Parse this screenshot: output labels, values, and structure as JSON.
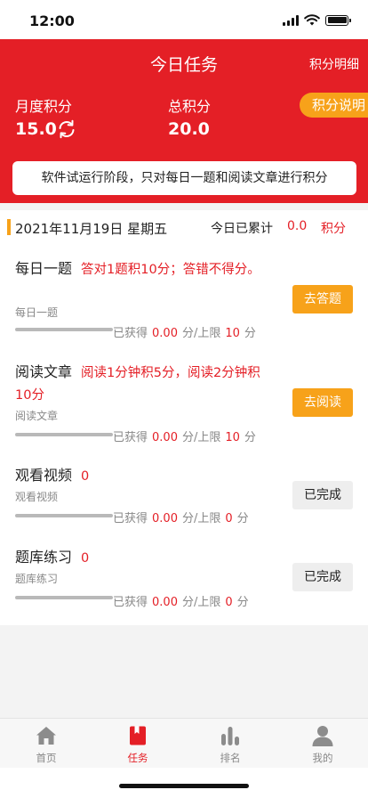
{
  "status_bar": {
    "time": "12:00"
  },
  "header": {
    "title": "今日任务",
    "detail_link": "积分明细",
    "monthly_label": "月度积分",
    "monthly_value": "15.0",
    "total_label": "总积分",
    "total_value": "20.0",
    "help_button": "积分说明",
    "notice": "软件试运行阶段，只对每日一题和阅读文章进行积分"
  },
  "summary": {
    "date": "2021年11月19日 星期五",
    "today_label": "今日已累计",
    "today_value": "0.0",
    "today_unit": "积分"
  },
  "tasks": [
    {
      "name": "每日一题",
      "rule": "答对1题积10分；答错不得分。",
      "subtitle": "每日一题",
      "earned_label": "已获得",
      "earned": "0.00",
      "limit_label": "分/上限",
      "limit": "10",
      "unit": "分",
      "progress": 0,
      "button": "去答题"
    },
    {
      "name": "阅读文章",
      "rule": "阅读1分钟积5分，阅读2分钟积10分",
      "subtitle": "阅读文章",
      "earned_label": "已获得",
      "earned": "0.00",
      "limit_label": "分/上限",
      "limit": "10",
      "unit": "分",
      "progress": 0,
      "button": "去阅读"
    },
    {
      "name": "观看视频",
      "rule": "0",
      "subtitle": "观看视频",
      "earned_label": "已获得",
      "earned": "0.00",
      "limit_label": "分/上限",
      "limit": "0",
      "unit": "分",
      "progress": 0,
      "button": "已完成"
    },
    {
      "name": "题库练习",
      "rule": "0",
      "subtitle": "题库练习",
      "earned_label": "已获得",
      "earned": "0.00",
      "limit_label": "分/上限",
      "limit": "0",
      "unit": "分",
      "progress": 0,
      "button": "已完成"
    }
  ],
  "tabbar": {
    "items": [
      {
        "label": "首页",
        "icon": "home-icon"
      },
      {
        "label": "任务",
        "icon": "task-book-icon"
      },
      {
        "label": "排名",
        "icon": "ranking-bars-icon"
      },
      {
        "label": "我的",
        "icon": "user-icon"
      }
    ],
    "active_index": 1
  },
  "colors": {
    "primary_red": "#e41f26",
    "accent_orange": "#f7a21a",
    "muted_gray": "#888888"
  }
}
